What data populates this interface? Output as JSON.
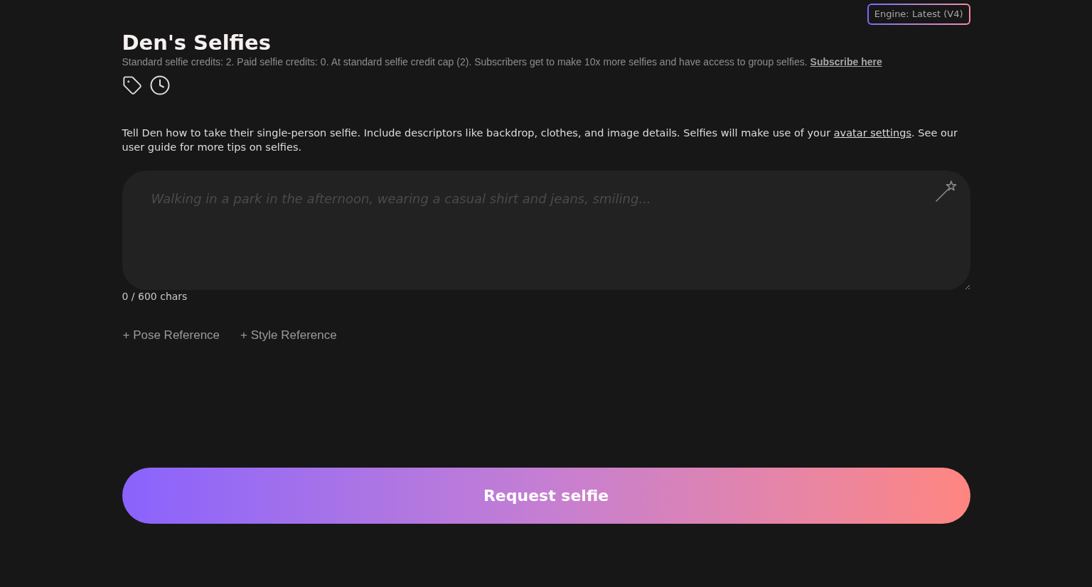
{
  "engine_badge": {
    "label": "Engine: Latest (V4)"
  },
  "header": {
    "title": "Den's Selfies",
    "credits_note": "Standard selfie credits: 2. Paid selfie credits: 0. At standard selfie credit cap (2). Subscribers get to make 10x more selfies and have access to group selfies. ",
    "subscribe_link": "Subscribe here"
  },
  "instructions": {
    "text_before": "Tell Den how to take their single-person selfie. Include descriptors like backdrop, clothes, and image details. Selfies will make use of your ",
    "link": "avatar settings",
    "text_after": ". See our user guide for more tips on selfies."
  },
  "prompt": {
    "placeholder": "Walking in a park in the afternoon, wearing a casual shirt and jeans, smiling..."
  },
  "char_count": "0 / 600 chars",
  "references": [
    {
      "label": "+ Pose Reference"
    },
    {
      "label": "+ Style Reference"
    }
  ],
  "submit": {
    "label": "Request selfie"
  }
}
